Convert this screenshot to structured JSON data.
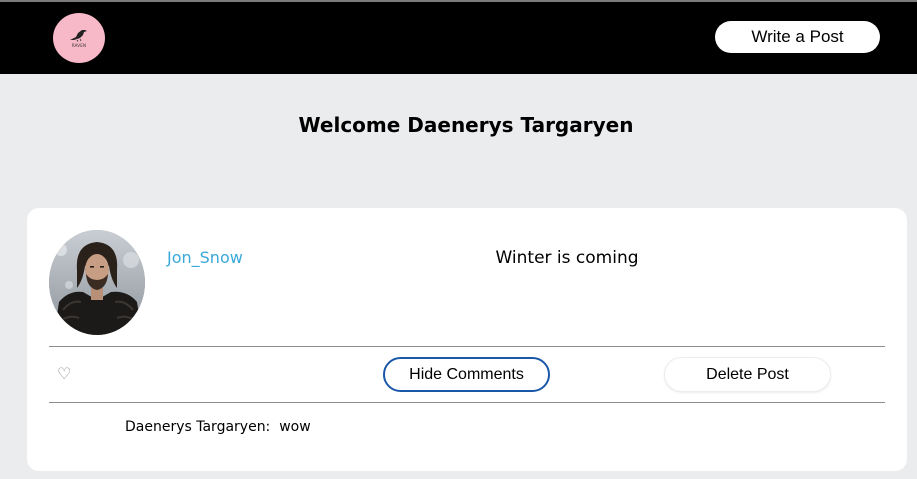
{
  "navbar": {
    "logo_text": "RAVEN",
    "write_post_label": "Write a Post"
  },
  "welcome": {
    "text": "Welcome Daenerys Targaryen"
  },
  "post": {
    "username": "Jon_Snow",
    "text": "Winter is coming",
    "like_icon": "♡",
    "hide_comments_label": "Hide Comments",
    "delete_post_label": "Delete Post",
    "comments": [
      {
        "author": "Daenerys Targaryen:",
        "text": "wow"
      }
    ]
  },
  "colors": {
    "navbar_bg": "#000000",
    "page_bg": "#ebecee",
    "logo_bg": "#f7b8c8",
    "username_link": "#3aa8d8",
    "hide_button_border": "#1b57a8"
  }
}
